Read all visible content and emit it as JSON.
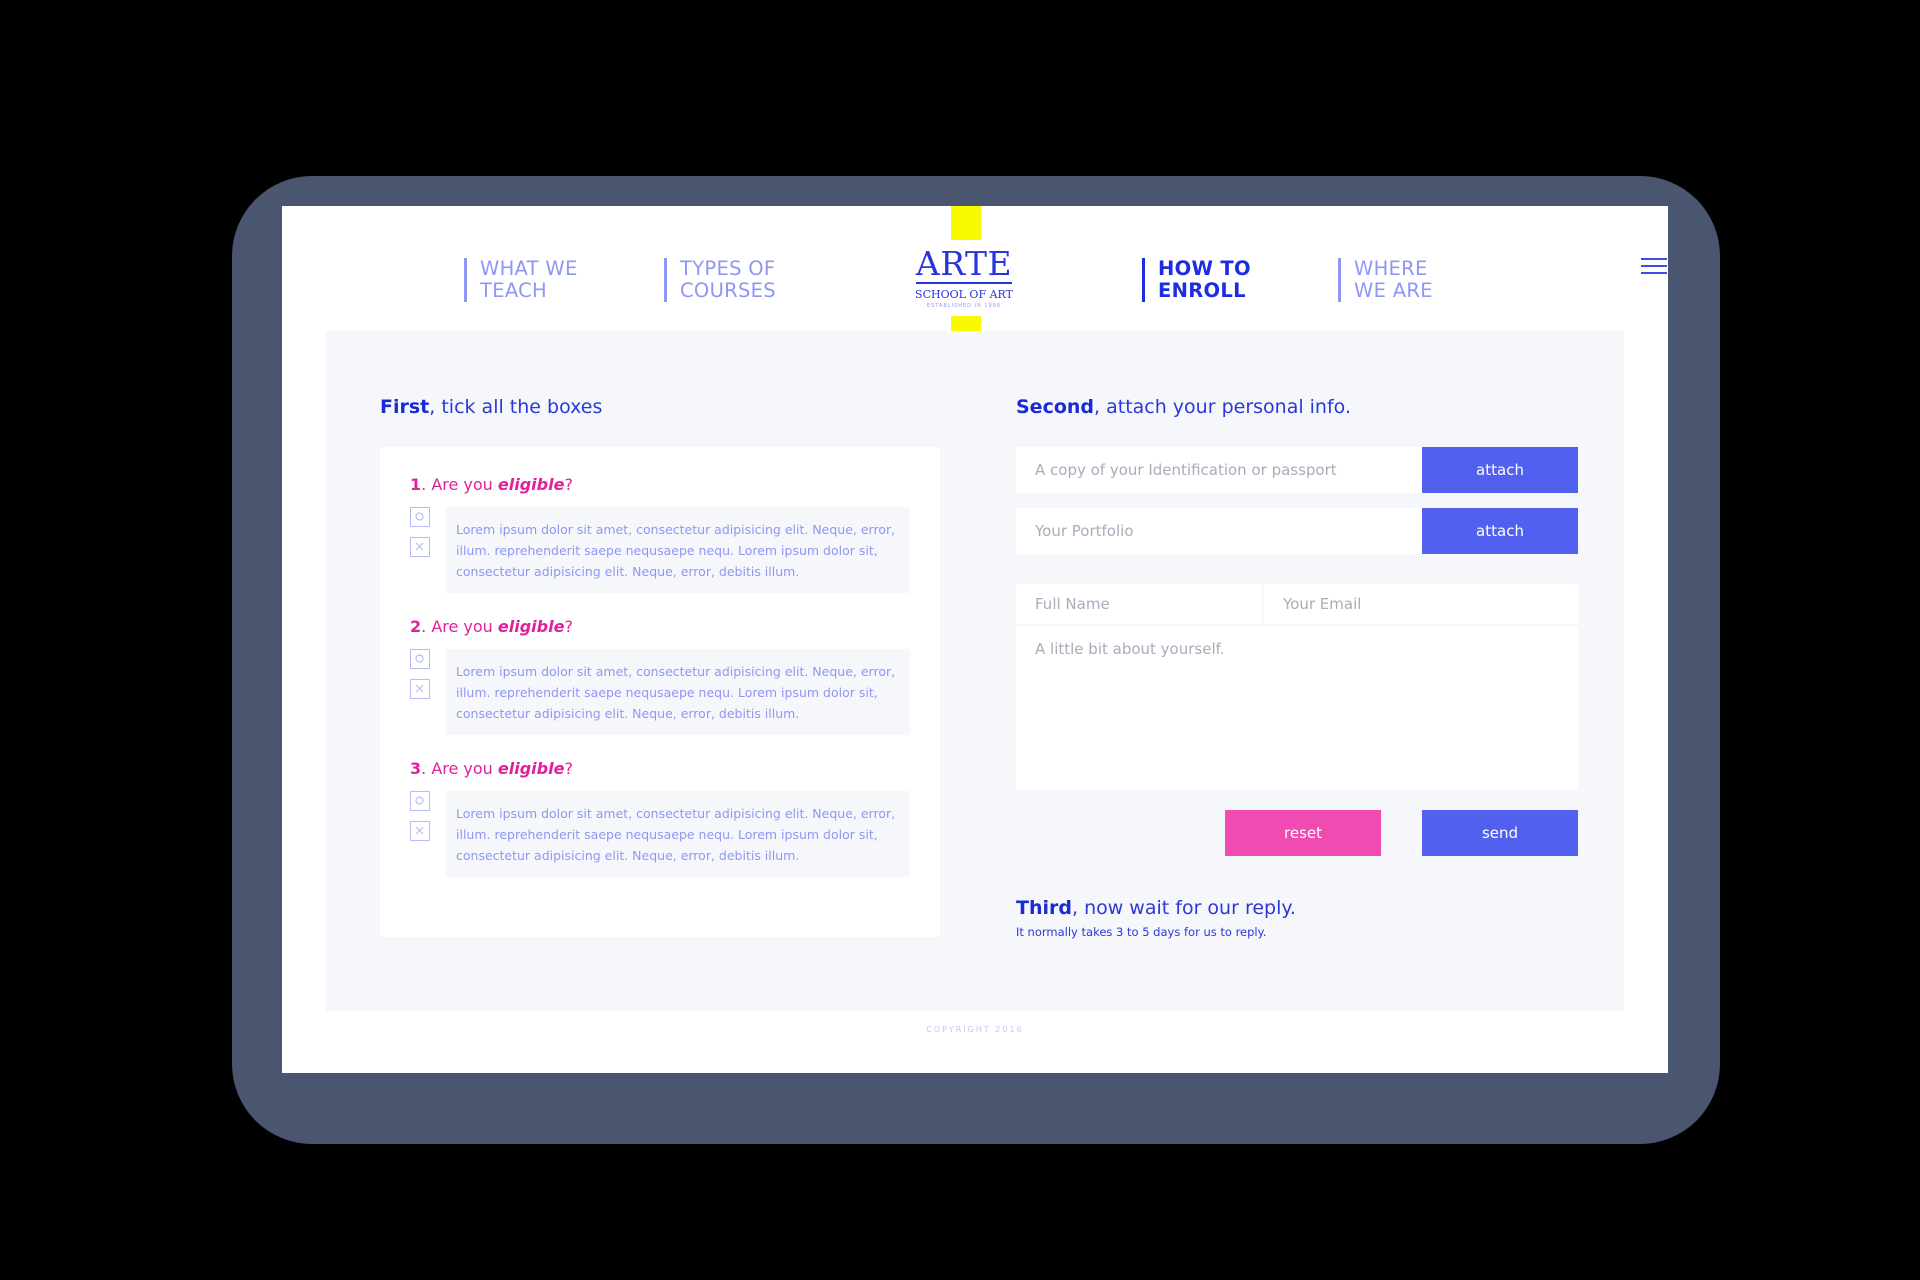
{
  "nav": {
    "items": [
      {
        "line1": "WHAT WE",
        "line2": "TEACH"
      },
      {
        "line1": "TYPES OF",
        "line2": "COURSES"
      },
      {
        "line1": "HOW TO",
        "line2": "ENROLL"
      },
      {
        "line1": "WHERE",
        "line2": "WE ARE"
      }
    ],
    "active_item": "HOW TO ENROLL",
    "menu_icon": "hamburger-menu-icon"
  },
  "logo": {
    "title": "ARTE",
    "subtitle": "SCHOOL OF ART",
    "established": "ESTABLISHED IN 1986"
  },
  "steps": {
    "first": {
      "bold": "First",
      "rest": ", tick all the boxes"
    },
    "second": {
      "bold": "Second",
      "rest": ", attach your personal info."
    },
    "third": {
      "bold": "Third",
      "rest": ", now wait for our reply.",
      "note": "It normally takes 3 to 5 days for us to reply."
    }
  },
  "questions": [
    {
      "number": "1",
      "prefix": ". Are you ",
      "emphasis": "eligible",
      "suffix": "?",
      "text": "Lorem ipsum dolor sit amet, consectetur adipisicing elit. Neque, error, illum. reprehenderit saepe nequsaepe nequ. Lorem ipsum dolor sit, consectetur adipisicing elit. Neque, error, debitis illum.",
      "options": [
        "circle-icon",
        "cross-icon"
      ]
    },
    {
      "number": "2",
      "prefix": ". Are you ",
      "emphasis": "eligible",
      "suffix": "?",
      "text": "Lorem ipsum dolor sit amet, consectetur adipisicing elit. Neque, error, illum. reprehenderit saepe nequsaepe nequ. Lorem ipsum dolor sit, consectetur adipisicing elit. Neque, error, debitis illum.",
      "options": [
        "circle-icon",
        "cross-icon"
      ]
    },
    {
      "number": "3",
      "prefix": ". Are you ",
      "emphasis": "eligible",
      "suffix": "?",
      "text": "Lorem ipsum dolor sit amet, consectetur adipisicing elit. Neque, error, illum. reprehenderit saepe nequsaepe nequ. Lorem ipsum dolor sit, consectetur adipisicing elit. Neque, error, debitis illum.",
      "options": [
        "circle-icon",
        "cross-icon"
      ]
    }
  ],
  "form": {
    "id_placeholder": "A copy of your Identification or passport",
    "portfolio_placeholder": "Your Portfolio",
    "attach_label": "attach",
    "name_placeholder": "Full Name",
    "email_placeholder": "Your Email",
    "about_placeholder": "A little bit about yourself.",
    "reset_label": "reset",
    "send_label": "send"
  },
  "footer": {
    "copyright": "COPYRIGHT 2016"
  },
  "colors": {
    "frame": "#4a5670",
    "primary_blue": "#1d2ee0",
    "light_blue": "#8e97f4",
    "button_blue": "#5160ee",
    "pink": "#f04bb2",
    "magenta_text": "#e0219b",
    "ribbon_yellow": "#f9f900",
    "panel_bg": "#f6f7fb"
  }
}
